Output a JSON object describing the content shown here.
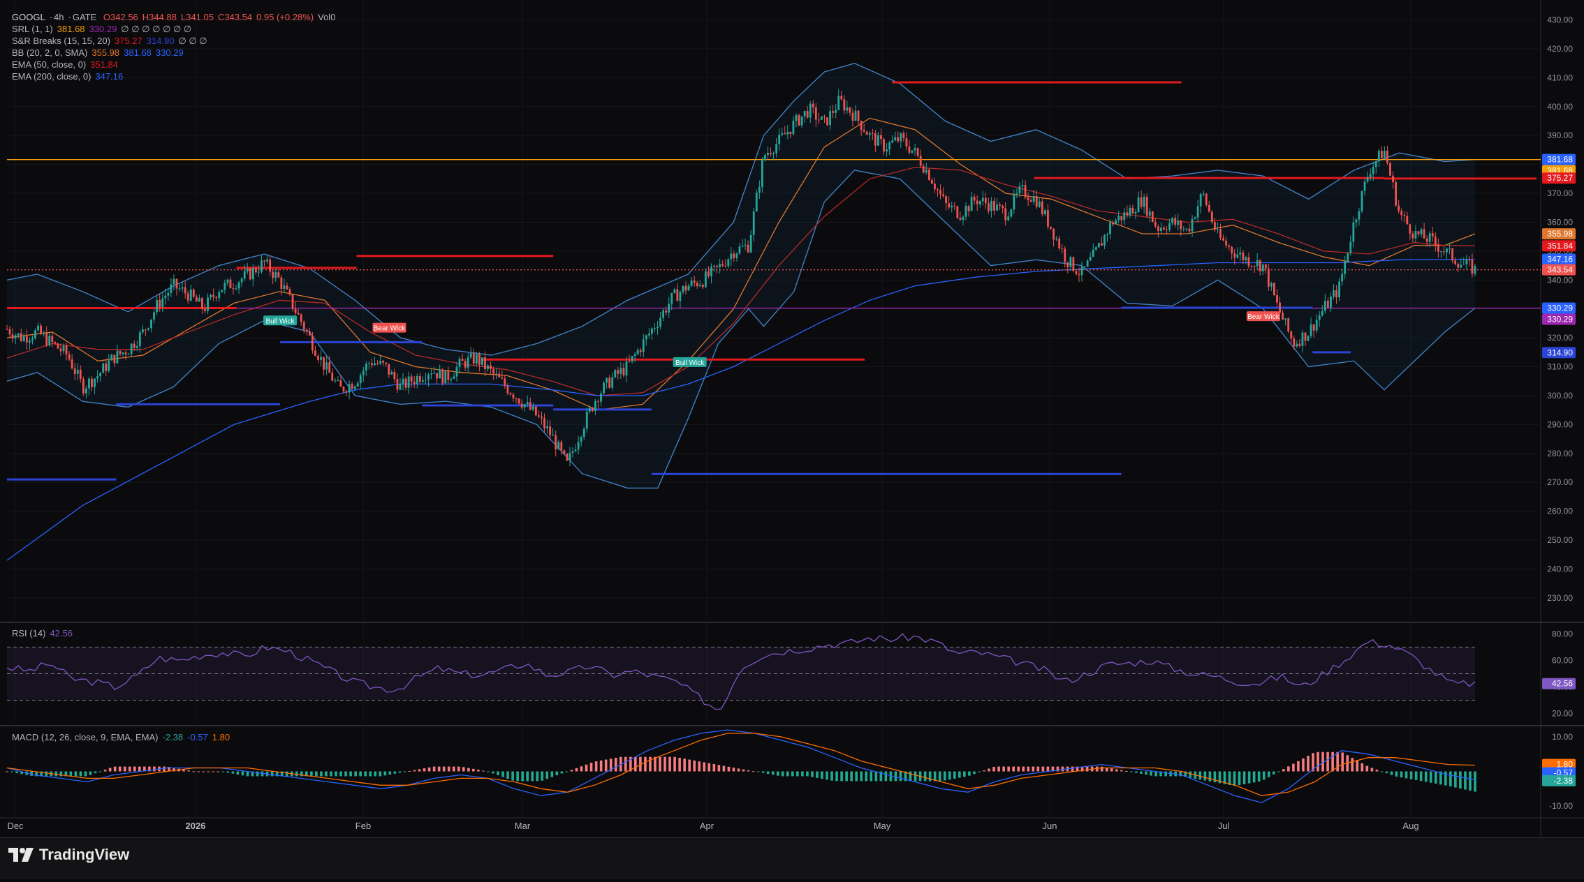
{
  "symbol": {
    "name": "GOOGL",
    "interval": "4h",
    "exchange": "GATE",
    "open": "O342.56",
    "high": "H344.88",
    "low": "L341.05",
    "close": "C343.54",
    "change": "0.95 (+0.28%)",
    "volume": "Vol0"
  },
  "indicators": {
    "srl": {
      "label": "SRL (1, 1)",
      "v1": "381.68",
      "v2": "330.29",
      "rest": "∅ ∅ ∅ ∅ ∅ ∅ ∅"
    },
    "snr": {
      "label": "S&R Breaks (15, 15, 20)",
      "v1": "375.27",
      "v2": "314.90",
      "rest": "∅ ∅ ∅"
    },
    "bb": {
      "label": "BB (20, 2, 0, SMA)",
      "basis": "355.98",
      "upper": "381.68",
      "lower": "330.29"
    },
    "ema50": {
      "label": "EMA (50, close, 0)",
      "value": "351.84"
    },
    "ema200": {
      "label": "EMA (200, close, 0)",
      "value": "347.16"
    },
    "rsi": {
      "label": "RSI (14)",
      "value": "42.56"
    },
    "macd": {
      "label": "MACD (12, 26, close, 9, EMA, EMA)",
      "hist": "-2.38",
      "macd": "-0.57",
      "signal": "1.80"
    }
  },
  "colors": {
    "bull": "#26a69a",
    "bear": "#ef5350",
    "bb": "#2962ff",
    "ema50": "#e0762c",
    "ema200": "#2962ff",
    "srl": "#f59e0b",
    "resist": "#e3191e",
    "support": "#2b44d6",
    "rsi": "#7e57c2",
    "macd": "#2962ff",
    "signal": "#ff6d00",
    "bg": "#0b0b0d"
  },
  "brand": "TradingView",
  "chart_data": {
    "type": "line",
    "x_labels": [
      "Dec",
      "2026",
      "Feb",
      "Mar",
      "Apr",
      "May",
      "Jun",
      "Jul",
      "Aug"
    ],
    "price_axis": {
      "ylim": [
        222,
        434
      ],
      "ticks": [
        230,
        240,
        250,
        260,
        270,
        280,
        290,
        300,
        310,
        320,
        330,
        340,
        350,
        360,
        370,
        380,
        390,
        400,
        410,
        420,
        430
      ],
      "tick_labels": [
        "230.00",
        "240.00",
        "250.00",
        "260.00",
        "270.00",
        "280.00",
        "290.00",
        "300.00",
        "310.00",
        "320.00",
        "330.00",
        "340.00",
        "350.00",
        "360.00",
        "370.00",
        "380.00",
        "390.00",
        "400.00",
        "410.00",
        "420.00",
        "430.00"
      ]
    },
    "price_badges": [
      {
        "text": "381.68",
        "color": "#2962ff",
        "value": 381.68
      },
      {
        "text": "381.68",
        "color": "#f59e0b",
        "value": 381.68
      },
      {
        "text": "375.27",
        "color": "#e3191e",
        "value": 375.27
      },
      {
        "text": "355.98",
        "color": "#e0762c",
        "value": 355.98
      },
      {
        "text": "351.84",
        "color": "#e3191e",
        "value": 351.84
      },
      {
        "text": "347.16",
        "color": "#2962ff",
        "value": 347.16
      },
      {
        "text": "343.54",
        "color": "#ef5350",
        "value": 343.54
      },
      {
        "text": "330.29",
        "color": "#2962ff",
        "value": 330.29
      },
      {
        "text": "330.29",
        "color": "#9c27b0",
        "value": 330.29
      },
      {
        "text": "314.90",
        "color": "#2b44d6",
        "value": 314.9
      }
    ],
    "close_series": [
      [
        0,
        323
      ],
      [
        0.02,
        320
      ],
      [
        0.04,
        322
      ],
      [
        0.06,
        318
      ],
      [
        0.08,
        314
      ],
      [
        0.1,
        303
      ],
      [
        0.12,
        307
      ],
      [
        0.14,
        313
      ],
      [
        0.16,
        316
      ],
      [
        0.18,
        322
      ],
      [
        0.2,
        332
      ],
      [
        0.22,
        338
      ],
      [
        0.24,
        335
      ],
      [
        0.26,
        330
      ],
      [
        0.28,
        337
      ],
      [
        0.3,
        339
      ],
      [
        0.32,
        342
      ],
      [
        0.34,
        346
      ],
      [
        0.36,
        340
      ],
      [
        0.38,
        330
      ],
      [
        0.4,
        320
      ],
      [
        0.42,
        310
      ],
      [
        0.44,
        302
      ],
      [
        0.46,
        305
      ],
      [
        0.48,
        312
      ],
      [
        0.5,
        310
      ],
      [
        0.52,
        303
      ],
      [
        0.54,
        306
      ],
      [
        0.56,
        309
      ],
      [
        0.58,
        306
      ],
      [
        0.6,
        311
      ],
      [
        0.62,
        313
      ],
      [
        0.64,
        308
      ],
      [
        0.66,
        303
      ],
      [
        0.68,
        298
      ],
      [
        0.7,
        293
      ],
      [
        0.72,
        286
      ],
      [
        0.74,
        276
      ],
      [
        0.76,
        289
      ],
      [
        0.78,
        300
      ],
      [
        0.8,
        306
      ],
      [
        0.82,
        310
      ],
      [
        0.84,
        318
      ],
      [
        0.86,
        326
      ],
      [
        0.88,
        334
      ],
      [
        0.9,
        338
      ],
      [
        0.92,
        340
      ],
      [
        0.94,
        344
      ],
      [
        0.96,
        350
      ],
      [
        0.98,
        352
      ],
      [
        1.0,
        383
      ],
      [
        1.02,
        388
      ],
      [
        1.04,
        394
      ],
      [
        1.06,
        399
      ],
      [
        1.08,
        394
      ],
      [
        1.1,
        402
      ],
      [
        1.12,
        397
      ],
      [
        1.14,
        390
      ],
      [
        1.16,
        386
      ],
      [
        1.18,
        389
      ],
      [
        1.2,
        384
      ],
      [
        1.22,
        376
      ],
      [
        1.24,
        366
      ],
      [
        1.26,
        363
      ],
      [
        1.28,
        368
      ],
      [
        1.3,
        366
      ],
      [
        1.32,
        363
      ],
      [
        1.34,
        371
      ],
      [
        1.36,
        368
      ],
      [
        1.38,
        358
      ],
      [
        1.4,
        347
      ],
      [
        1.42,
        342
      ],
      [
        1.44,
        350
      ],
      [
        1.46,
        360
      ],
      [
        1.48,
        363
      ],
      [
        1.5,
        368
      ],
      [
        1.52,
        358
      ],
      [
        1.54,
        360
      ],
      [
        1.56,
        357
      ],
      [
        1.58,
        370
      ],
      [
        1.6,
        355
      ],
      [
        1.62,
        350
      ],
      [
        1.64,
        347
      ],
      [
        1.66,
        345
      ],
      [
        1.68,
        330
      ],
      [
        1.7,
        318
      ],
      [
        1.72,
        322
      ],
      [
        1.74,
        330
      ],
      [
        1.76,
        337
      ],
      [
        1.78,
        360
      ],
      [
        1.8,
        378
      ],
      [
        1.82,
        385
      ],
      [
        1.84,
        363
      ],
      [
        1.86,
        356
      ],
      [
        1.88,
        354
      ],
      [
        1.9,
        350
      ],
      [
        1.92,
        346
      ],
      [
        1.94,
        343.54
      ]
    ],
    "x_span": [
      0,
      1.94
    ],
    "bb_upper": [
      [
        0,
        340
      ],
      [
        0.04,
        342
      ],
      [
        0.1,
        336
      ],
      [
        0.16,
        329
      ],
      [
        0.22,
        338
      ],
      [
        0.28,
        345
      ],
      [
        0.34,
        349
      ],
      [
        0.4,
        344
      ],
      [
        0.46,
        333
      ],
      [
        0.52,
        320
      ],
      [
        0.58,
        316
      ],
      [
        0.64,
        314
      ],
      [
        0.7,
        318
      ],
      [
        0.76,
        324
      ],
      [
        0.82,
        333
      ],
      [
        0.9,
        342
      ],
      [
        0.96,
        360
      ],
      [
        1.0,
        390
      ],
      [
        1.04,
        402
      ],
      [
        1.08,
        412
      ],
      [
        1.12,
        415
      ],
      [
        1.18,
        408
      ],
      [
        1.24,
        395
      ],
      [
        1.3,
        388
      ],
      [
        1.36,
        392
      ],
      [
        1.42,
        385
      ],
      [
        1.48,
        375
      ],
      [
        1.54,
        376
      ],
      [
        1.6,
        378
      ],
      [
        1.66,
        376
      ],
      [
        1.72,
        368
      ],
      [
        1.78,
        378
      ],
      [
        1.84,
        384
      ],
      [
        1.9,
        381
      ],
      [
        1.94,
        381.68
      ]
    ],
    "bb_lower": [
      [
        0,
        305
      ],
      [
        0.04,
        308
      ],
      [
        0.1,
        298
      ],
      [
        0.16,
        296
      ],
      [
        0.22,
        303
      ],
      [
        0.28,
        318
      ],
      [
        0.34,
        326
      ],
      [
        0.4,
        322
      ],
      [
        0.46,
        300
      ],
      [
        0.52,
        297
      ],
      [
        0.58,
        298
      ],
      [
        0.64,
        296
      ],
      [
        0.7,
        290
      ],
      [
        0.76,
        273
      ],
      [
        0.82,
        268
      ],
      [
        0.86,
        268
      ],
      [
        0.9,
        292
      ],
      [
        0.94,
        318
      ],
      [
        0.98,
        330
      ],
      [
        1.0,
        324
      ],
      [
        1.04,
        336
      ],
      [
        1.08,
        367
      ],
      [
        1.12,
        378
      ],
      [
        1.18,
        375
      ],
      [
        1.24,
        360
      ],
      [
        1.3,
        345
      ],
      [
        1.36,
        347
      ],
      [
        1.42,
        345
      ],
      [
        1.48,
        332
      ],
      [
        1.54,
        331
      ],
      [
        1.6,
        340
      ],
      [
        1.66,
        330
      ],
      [
        1.72,
        310
      ],
      [
        1.78,
        312
      ],
      [
        1.82,
        302
      ],
      [
        1.86,
        312
      ],
      [
        1.9,
        322
      ],
      [
        1.94,
        330.29
      ]
    ],
    "bb_basis": [
      [
        0,
        320
      ],
      [
        0.06,
        322
      ],
      [
        0.12,
        312
      ],
      [
        0.18,
        314
      ],
      [
        0.24,
        323
      ],
      [
        0.3,
        332
      ],
      [
        0.36,
        336
      ],
      [
        0.42,
        333
      ],
      [
        0.48,
        315
      ],
      [
        0.54,
        310
      ],
      [
        0.6,
        308
      ],
      [
        0.66,
        307
      ],
      [
        0.72,
        302
      ],
      [
        0.78,
        295
      ],
      [
        0.84,
        297
      ],
      [
        0.9,
        312
      ],
      [
        0.96,
        330
      ],
      [
        1.02,
        360
      ],
      [
        1.08,
        386
      ],
      [
        1.14,
        396
      ],
      [
        1.2,
        392
      ],
      [
        1.26,
        380
      ],
      [
        1.32,
        370
      ],
      [
        1.38,
        368
      ],
      [
        1.44,
        362
      ],
      [
        1.5,
        356
      ],
      [
        1.56,
        356
      ],
      [
        1.62,
        359
      ],
      [
        1.68,
        353
      ],
      [
        1.74,
        348
      ],
      [
        1.8,
        345
      ],
      [
        1.86,
        352
      ],
      [
        1.9,
        352
      ],
      [
        1.94,
        355.98
      ]
    ],
    "ema50": [
      [
        0,
        313
      ],
      [
        0.06,
        318
      ],
      [
        0.12,
        316
      ],
      [
        0.18,
        316
      ],
      [
        0.24,
        322
      ],
      [
        0.3,
        328
      ],
      [
        0.36,
        333
      ],
      [
        0.42,
        332
      ],
      [
        0.48,
        322
      ],
      [
        0.54,
        314
      ],
      [
        0.6,
        311
      ],
      [
        0.66,
        309
      ],
      [
        0.72,
        305
      ],
      [
        0.78,
        300
      ],
      [
        0.84,
        301
      ],
      [
        0.9,
        310
      ],
      [
        0.96,
        325
      ],
      [
        1.02,
        345
      ],
      [
        1.08,
        362
      ],
      [
        1.14,
        375
      ],
      [
        1.2,
        379
      ],
      [
        1.26,
        378
      ],
      [
        1.32,
        373
      ],
      [
        1.38,
        369
      ],
      [
        1.44,
        364
      ],
      [
        1.5,
        362
      ],
      [
        1.56,
        360
      ],
      [
        1.62,
        361
      ],
      [
        1.68,
        356
      ],
      [
        1.74,
        350
      ],
      [
        1.8,
        349
      ],
      [
        1.86,
        353
      ],
      [
        1.9,
        352
      ],
      [
        1.94,
        351.84
      ]
    ],
    "ema200": [
      [
        0,
        243
      ],
      [
        0.1,
        262
      ],
      [
        0.2,
        276
      ],
      [
        0.3,
        290
      ],
      [
        0.4,
        298
      ],
      [
        0.46,
        302
      ],
      [
        0.52,
        304
      ],
      [
        0.58,
        304
      ],
      [
        0.64,
        304
      ],
      [
        0.72,
        302
      ],
      [
        0.78,
        300
      ],
      [
        0.84,
        300
      ],
      [
        0.9,
        304
      ],
      [
        0.96,
        310
      ],
      [
        1.02,
        318
      ],
      [
        1.08,
        326
      ],
      [
        1.14,
        333
      ],
      [
        1.2,
        338
      ],
      [
        1.28,
        341
      ],
      [
        1.36,
        343
      ],
      [
        1.44,
        344
      ],
      [
        1.52,
        345
      ],
      [
        1.6,
        346
      ],
      [
        1.68,
        346
      ],
      [
        1.76,
        346
      ],
      [
        1.84,
        347
      ],
      [
        1.94,
        347.16
      ]
    ],
    "hlines": [
      {
        "value": 381.68,
        "color": "#f59e0b"
      },
      {
        "value": 330.29,
        "color": "#9c27b0"
      },
      {
        "value": 343.54,
        "color": "#ef5350",
        "dotted": true
      }
    ],
    "resistance_segments": [
      [
        0,
        0.42,
        330.3
      ],
      [
        0.42,
        0.64,
        344.2
      ],
      [
        0.64,
        1.0,
        348.3
      ],
      [
        0.87,
        1.57,
        312.5
      ],
      [
        1.62,
        2.15,
        408.4
      ],
      [
        1.88,
        2.52,
        375.3
      ],
      [
        2.52,
        2.8,
        375.1
      ]
    ],
    "support_segments": [
      [
        0.0,
        0.2,
        271
      ],
      [
        0.2,
        0.5,
        297
      ],
      [
        0.5,
        0.76,
        318.5
      ],
      [
        0.76,
        1.0,
        296.6
      ],
      [
        1.0,
        1.18,
        295.2
      ],
      [
        1.18,
        2.04,
        272.9
      ],
      [
        2.04,
        2.39,
        330.4
      ],
      [
        2.39,
        2.46,
        315
      ]
    ],
    "labels": [
      {
        "text": "Bull Wick",
        "x": 0.5,
        "value": 326,
        "color": "#26a69a"
      },
      {
        "text": "Bear Wick",
        "x": 0.7,
        "value": 323.5,
        "color": "#ef5350"
      },
      {
        "text": "Bull Wick",
        "x": 1.25,
        "value": 311.6,
        "color": "#26a69a"
      },
      {
        "text": "Bear Wick",
        "x": 2.3,
        "value": 327.5,
        "color": "#ef5350"
      }
    ],
    "rsi": {
      "ylim": [
        12,
        88
      ],
      "ticks": [
        20,
        40,
        60,
        80
      ],
      "tick_labels": [
        "20.00",
        "40.00",
        "60.00",
        "80.00"
      ],
      "levels": [
        70,
        50,
        30
      ],
      "value_label": "42.56",
      "series": [
        55,
        52,
        58,
        46,
        44,
        40,
        48,
        62,
        60,
        64,
        66,
        63,
        70,
        67,
        60,
        52,
        44,
        40,
        38,
        47,
        54,
        50,
        49,
        53,
        58,
        49,
        51,
        56,
        49,
        52,
        48,
        44,
        33,
        22,
        55,
        64,
        67,
        69,
        72,
        73,
        77,
        76,
        78,
        74,
        65,
        66,
        62,
        58,
        53,
        44,
        50,
        57,
        58,
        60,
        54,
        50,
        48,
        44,
        43,
        48,
        40,
        50,
        61,
        74,
        72,
        64,
        52,
        42,
        43
      ]
    },
    "macd": {
      "ylim": [
        -13,
        13
      ],
      "ticks": [
        -10,
        0,
        10
      ],
      "tick_labels": [
        "-10.00",
        "",
        "10.00"
      ],
      "macd_series": [
        1,
        -1,
        -2,
        -3,
        -1,
        0,
        1,
        1,
        1,
        0,
        -1,
        -2,
        -3,
        -4,
        -5,
        -4,
        -2,
        -1,
        -2,
        -5,
        -7,
        -6,
        -2,
        2,
        6,
        9,
        11,
        12,
        11,
        9,
        7,
        4,
        1,
        -1,
        -3,
        -5,
        -6,
        -3,
        -1,
        0,
        1,
        2,
        1,
        0,
        -1,
        -4,
        -7,
        -9,
        -5,
        1,
        6,
        5,
        3,
        1,
        -1,
        -2.38
      ],
      "signal_series": [
        1,
        0,
        -1,
        -2,
        -2,
        -1,
        0,
        1,
        1,
        1,
        0,
        -1,
        -2,
        -3,
        -4,
        -4,
        -3,
        -2,
        -2,
        -3,
        -5,
        -6,
        -4,
        -1,
        3,
        6,
        9,
        11,
        11,
        10,
        8,
        6,
        3,
        1,
        -1,
        -3,
        -5,
        -4,
        -2,
        -1,
        0,
        1,
        1,
        1,
        0,
        -2,
        -4,
        -7,
        -6,
        -3,
        2,
        4,
        4,
        3,
        2,
        1.8
      ],
      "badges": [
        {
          "text": "1.80",
          "color": "#ff6d00",
          "value": 2.0
        },
        {
          "text": "-0.57",
          "color": "#2962ff",
          "value": -0.4
        },
        {
          "text": "-2.38",
          "color": "#26a69a",
          "value": -2.7
        }
      ]
    }
  }
}
